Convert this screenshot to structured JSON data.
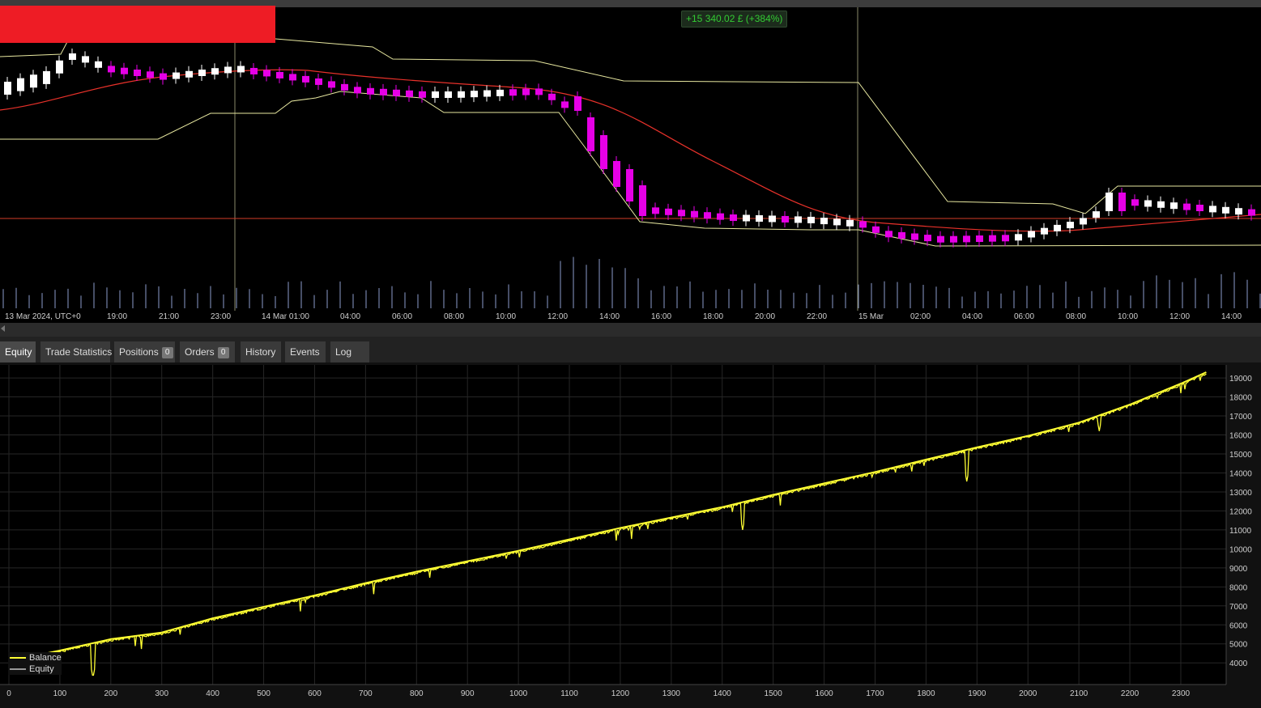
{
  "pnl_badge": "+15 340.02 £ (+384%)",
  "price_chart": {
    "time_labels": [
      "13 Mar 2024, UTC+0",
      "19:00",
      "21:00",
      "23:00",
      "14 Mar 01:00",
      "04:00",
      "06:00",
      "08:00",
      "10:00",
      "12:00",
      "14:00",
      "16:00",
      "18:00",
      "20:00",
      "22:00",
      "15 Mar",
      "02:00",
      "04:00",
      "06:00",
      "08:00",
      "10:00",
      "12:00",
      "14:00"
    ],
    "colors": {
      "bull": "#ffffff",
      "bear": "#e600e6",
      "ma": "#e8312a",
      "channel": "#e8e8a0",
      "volume": "#8c9ccc",
      "hline": "#d23c28",
      "vline": "#8a8a6a"
    }
  },
  "tabs": [
    {
      "id": "equity",
      "label": "Equity"
    },
    {
      "id": "trade-statistics",
      "label": "Trade Statistics"
    },
    {
      "id": "positions",
      "label": "Positions",
      "count": "0"
    },
    {
      "id": "orders",
      "label": "Orders",
      "count": "0"
    },
    {
      "id": "history",
      "label": "History"
    },
    {
      "id": "events",
      "label": "Events"
    },
    {
      "id": "log",
      "label": "Log"
    }
  ],
  "chart_data": {
    "type": "line",
    "x_ticks": [
      0,
      100,
      200,
      300,
      400,
      500,
      600,
      700,
      800,
      900,
      1000,
      1100,
      1200,
      1300,
      1400,
      1500,
      1600,
      1700,
      1800,
      1900,
      2000,
      2100,
      2200,
      2300
    ],
    "y_ticks": [
      4000,
      5000,
      6000,
      7000,
      8000,
      9000,
      10000,
      11000,
      12000,
      13000,
      14000,
      15000,
      16000,
      17000,
      18000,
      19000
    ],
    "xlim": [
      0,
      2370
    ],
    "ylim": [
      3200,
      19600
    ],
    "grid": true,
    "legend_position": "bottom-left",
    "series": [
      {
        "name": "Balance",
        "color": "#ffff33",
        "x": [
          0,
          100,
          200,
          300,
          400,
          500,
          600,
          700,
          800,
          900,
          1000,
          1100,
          1200,
          1300,
          1400,
          1500,
          1600,
          1700,
          1800,
          1900,
          2000,
          2100,
          2200,
          2300,
          2350
        ],
        "y": [
          4100,
          4650,
          5250,
          5600,
          6350,
          6950,
          7550,
          8200,
          8800,
          9350,
          9900,
          10500,
          11100,
          11650,
          12200,
          12850,
          13450,
          14050,
          14700,
          15350,
          15950,
          16650,
          17600,
          18700,
          19300
        ]
      },
      {
        "name": "Equity",
        "color": "#999999",
        "dips": [
          {
            "x": 165,
            "y": 3200
          },
          {
            "x": 455,
            "y": 7000
          },
          {
            "x": 580,
            "y": 7600
          },
          {
            "x": 820,
            "y": 10400
          },
          {
            "x": 1150,
            "y": 10700
          },
          {
            "x": 1440,
            "y": 11000
          },
          {
            "x": 1880,
            "y": 13550
          },
          {
            "x": 2140,
            "y": 16200
          }
        ]
      }
    ]
  }
}
